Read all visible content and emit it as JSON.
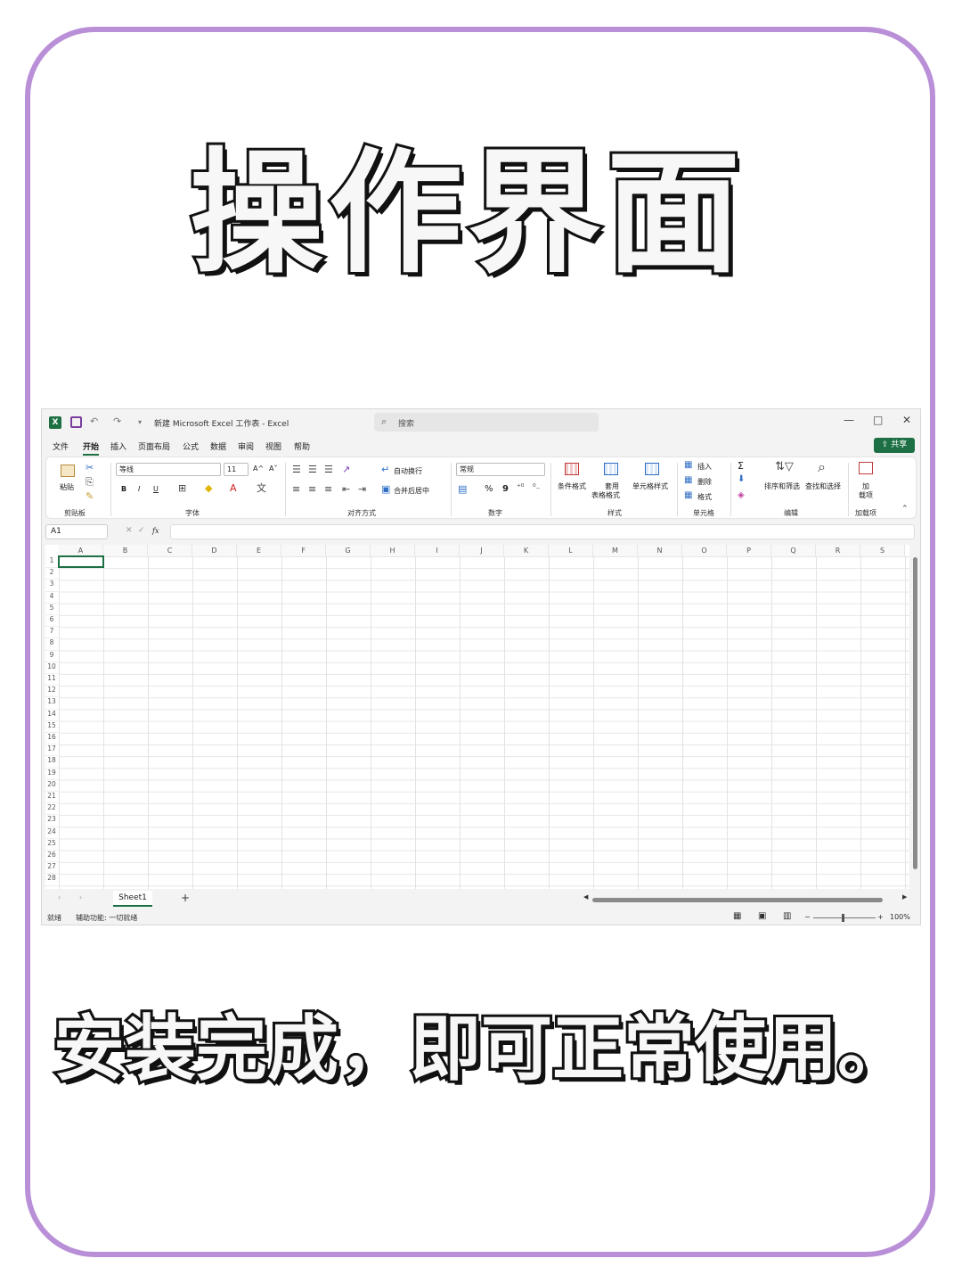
{
  "headline": "操作界面",
  "caption": "安装完成，即可正常使用。",
  "colors": {
    "frame": "#b98fd8",
    "excel_green": "#1d7044"
  },
  "excel": {
    "window_title": "新建 Microsoft Excel 工作表 - Excel",
    "search_placeholder": "搜索",
    "window_buttons": {
      "minimize": "—",
      "maximize": "□",
      "close": "✕"
    },
    "menu": [
      "文件",
      "开始",
      "插入",
      "页面布局",
      "公式",
      "数据",
      "审阅",
      "视图",
      "帮助"
    ],
    "active_menu": "开始",
    "share_label": "共享",
    "ribbon": {
      "clipboard": {
        "paste": "粘贴",
        "label": "剪贴板"
      },
      "font": {
        "name": "等线",
        "size": "11",
        "bold": "B",
        "italic": "I",
        "underline": "U",
        "grow": "A^",
        "shrink": "A˅",
        "label": "字体"
      },
      "alignment": {
        "wrap": "自动换行",
        "merge": "合并后居中",
        "label": "对齐方式"
      },
      "number": {
        "format": "常规",
        "percent": "%",
        "comma": "9",
        "label": "数字"
      },
      "styles": {
        "conditional": "条件格式",
        "table_line1": "套用",
        "table_line2": "表格格式",
        "cell_styles": "单元格样式",
        "label": "样式"
      },
      "cells": {
        "insert": "插入",
        "delete": "删除",
        "format": "格式",
        "label": "单元格"
      },
      "editing": {
        "sum": "Σ",
        "sort": "排序和筛选",
        "find": "查找和选择",
        "label": "编辑"
      },
      "addins": {
        "line1": "加",
        "line2": "载项",
        "label": "加载项"
      }
    },
    "name_box": "A1",
    "fx_label": "fx",
    "columns": [
      "A",
      "B",
      "C",
      "D",
      "E",
      "F",
      "G",
      "H",
      "I",
      "J",
      "K",
      "L",
      "M",
      "N",
      "O",
      "P",
      "Q",
      "R",
      "S"
    ],
    "rows": [
      "1",
      "2",
      "3",
      "4",
      "5",
      "6",
      "7",
      "8",
      "9",
      "10",
      "11",
      "12",
      "13",
      "14",
      "15",
      "16",
      "17",
      "18",
      "19",
      "20",
      "21",
      "22",
      "23",
      "24",
      "25",
      "26",
      "27",
      "28"
    ],
    "sheet_tab": "Sheet1",
    "add_sheet": "+",
    "status": {
      "ready": "就绪",
      "accessibility": "辅助功能: 一切就绪",
      "zoom": "100%"
    }
  }
}
